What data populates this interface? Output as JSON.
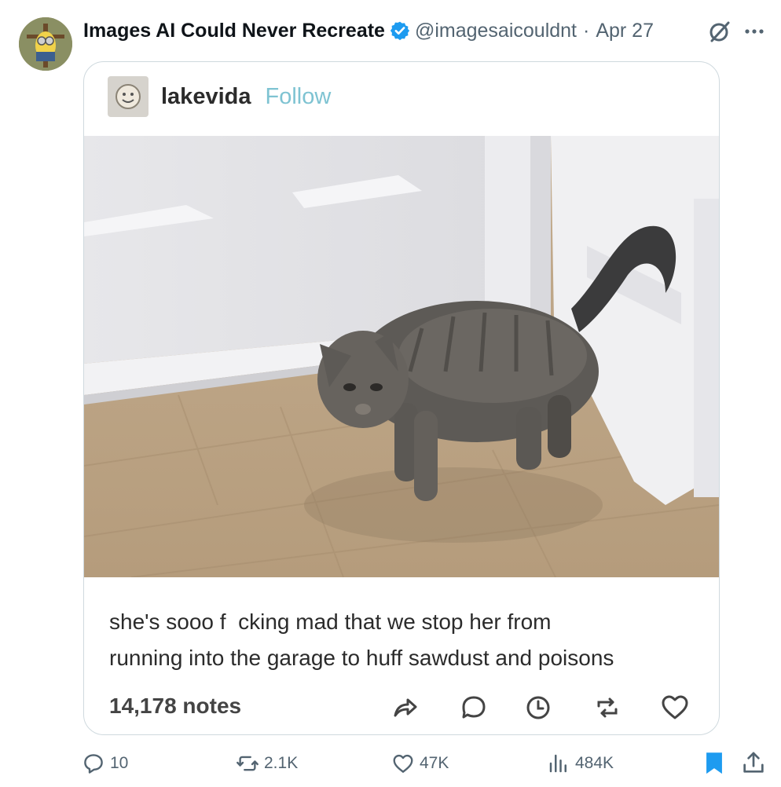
{
  "post": {
    "author_name": "Images AI Could Never Recreate",
    "handle": "@imagesaicouldnt",
    "separator": "·",
    "date": "Apr 27"
  },
  "card": {
    "username": "lakevida",
    "follow_label": "Follow",
    "caption_lines": [
      "she's sooo f  cking mad that we stop her from",
      "running into the garage to huff sawdust and poisons"
    ],
    "notes": "14,178 notes"
  },
  "actions": {
    "replies": "10",
    "reposts": "2.1K",
    "likes": "47K",
    "views": "484K"
  },
  "colors": {
    "verified": "#1d9bf0",
    "bookmark": "#1d9bf0",
    "follow": "#7ec3d2",
    "secondary_text": "#536471",
    "card_border": "#cfd9de"
  },
  "icons": [
    "verified-badge-icon",
    "grok-icon",
    "more-icon",
    "share-icon",
    "reply-bubble-icon",
    "clock-icon",
    "reblog-icon",
    "heart-icon",
    "reply-icon",
    "repost-icon",
    "like-icon",
    "views-icon",
    "bookmark-icon",
    "upload-icon"
  ]
}
